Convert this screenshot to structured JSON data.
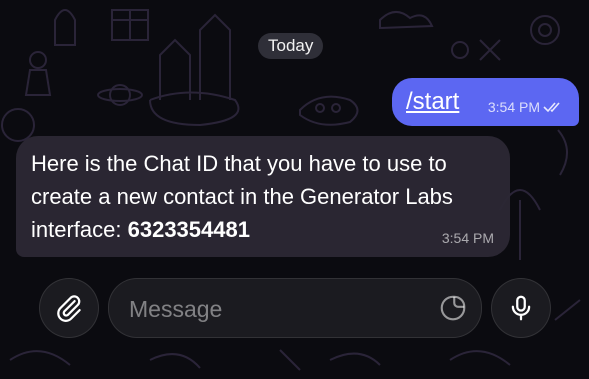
{
  "date_separator": "Today",
  "outgoing": {
    "text": "/start",
    "time": "3:54 PM",
    "status_icon": "double-check-icon"
  },
  "incoming": {
    "text_before": "Here is the Chat ID that you have to use to create a new contact in the Generator Labs interface: ",
    "chat_id": "6323354481",
    "time": "3:54 PM"
  },
  "composer": {
    "placeholder": "Message",
    "attach_icon": "paperclip-icon",
    "sticker_icon": "sticker-icon",
    "mic_icon": "microphone-icon"
  },
  "colors": {
    "outgoing_bubble": "#5c67f2",
    "incoming_bubble": "#2c2834",
    "background": "#0b0b10"
  }
}
